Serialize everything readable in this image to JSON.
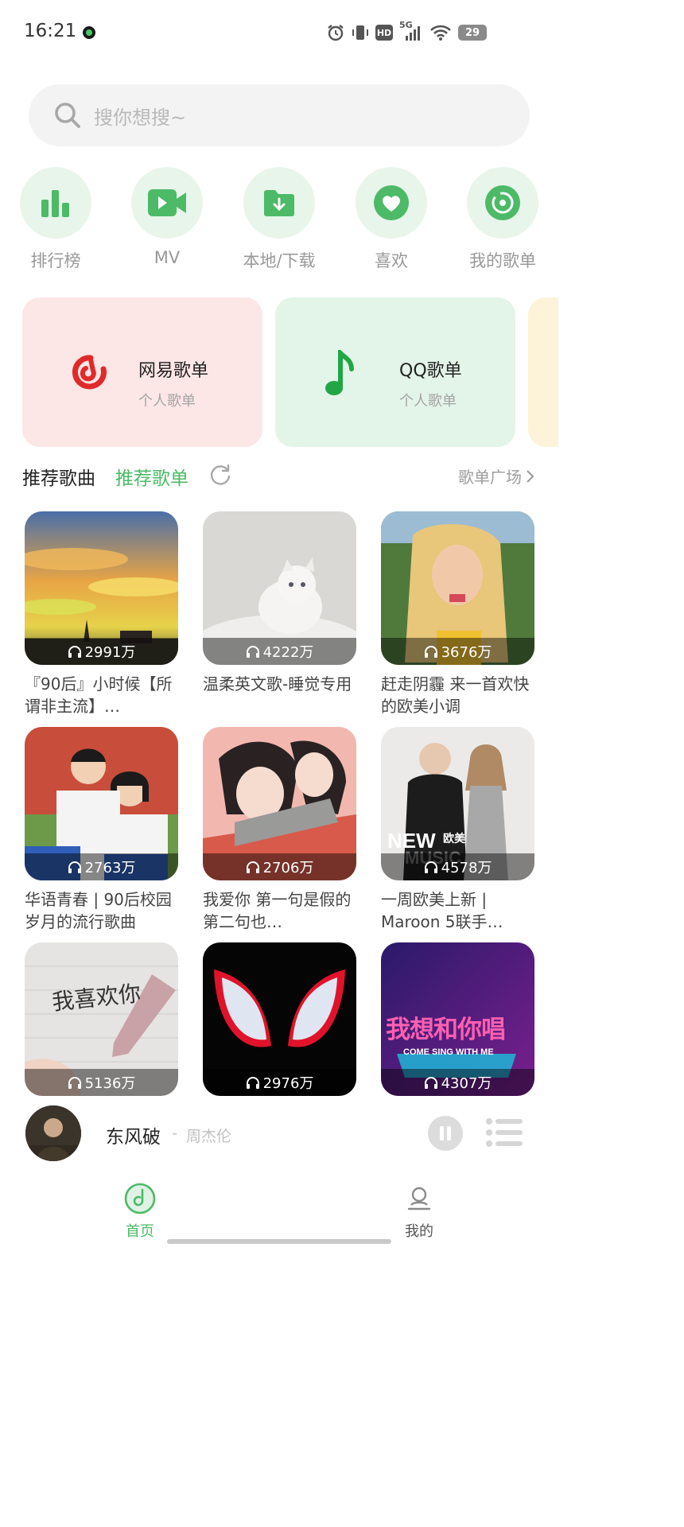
{
  "status_bar": {
    "time": "16:21",
    "network": "5G",
    "hd": "HD",
    "battery": "29"
  },
  "search": {
    "placeholder": "搜你想搜~"
  },
  "quick_entries": [
    {
      "label": "排行榜",
      "icon": "bar-chart-icon"
    },
    {
      "label": "MV",
      "icon": "video-camera-icon"
    },
    {
      "label": "本地/下载",
      "icon": "download-folder-icon"
    },
    {
      "label": "喜欢",
      "icon": "heart-icon"
    },
    {
      "label": "我的歌单",
      "icon": "disc-icon"
    }
  ],
  "source_cards": [
    {
      "title": "网易歌单",
      "subtitle": "个人歌单",
      "bg": "#fde6e6",
      "icon": "netease-cloud-music-icon"
    },
    {
      "title": "QQ歌单",
      "subtitle": "个人歌单",
      "bg": "#e3f4e8",
      "icon": "qq-music-note-icon"
    },
    {
      "title": "",
      "subtitle": "",
      "bg": "#fdf3d9",
      "icon": ""
    }
  ],
  "section": {
    "tab_songs": "推荐歌曲",
    "tab_playlists": "推荐歌单",
    "plaza_link": "歌单广场"
  },
  "playlists": [
    {
      "name": "『90后』小时候【所谓非主流】…",
      "count": "2991万",
      "cover": "sunset-sky-cover"
    },
    {
      "name": "温柔英文歌-睡觉专用",
      "count": "4222万",
      "cover": "white-kitten-cover"
    },
    {
      "name": "赶走阴霾 来一首欢快的欧美小调",
      "count": "3676万",
      "cover": "blonde-girl-cover"
    },
    {
      "name": "华语青春 | 90后校园岁月的流行歌曲",
      "count": "2763万",
      "cover": "school-couple-cover"
    },
    {
      "name": "我爱你  第一句是假的  第二句也…",
      "count": "2706万",
      "cover": "illustrated-couple-cover"
    },
    {
      "name": "一周欧美上新 | Maroon 5联手…",
      "count": "4578万",
      "cover": "new-music-cover",
      "cover_text": "NEW",
      "cover_text_small": "欧美",
      "cover_text_faint": "MUSIC"
    },
    {
      "name": "",
      "count": "5136万",
      "cover": "handwritten-note-cover",
      "cover_text": "我喜欢你"
    },
    {
      "name": "",
      "count": "2976万",
      "cover": "spider-mask-cover"
    },
    {
      "name": "",
      "count": "4307万",
      "cover": "sing-show-cover",
      "cover_text": "我想和你唱",
      "cover_text_small": "COME SING WITH ME"
    }
  ],
  "now_playing": {
    "title": "东风破",
    "separator": "-",
    "artist": "周杰伦"
  },
  "bottom_nav": [
    {
      "label": "首页",
      "active": true,
      "icon": "music-disc-icon"
    },
    {
      "label": "我的",
      "active": false,
      "icon": "user-icon"
    }
  ],
  "colors": {
    "accent": "#4cba67",
    "accent_light": "#e8f5ea",
    "netease_red": "#e02a2a",
    "qq_green": "#22a645"
  }
}
